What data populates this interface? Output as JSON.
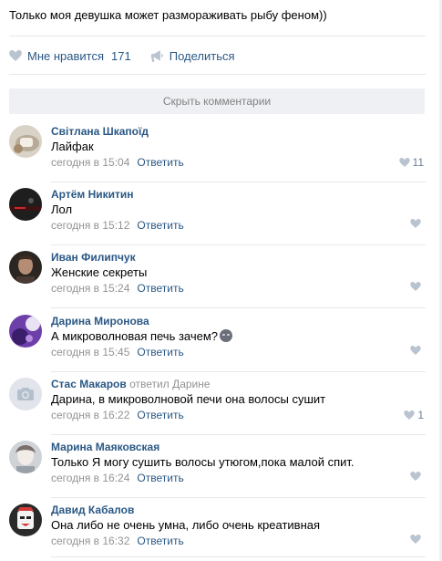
{
  "post": {
    "text": "Только моя девушка может размораживать рыбу феном))",
    "like_label": "Мне нравится",
    "like_count": "171",
    "share_label": "Поделиться"
  },
  "hide_comments_label": "Скрыть комментарии",
  "reply_label": "Ответить",
  "comments": [
    {
      "author": "Світлана Шкапоїд",
      "text": "Лайфак",
      "time": "сегодня в 15:04",
      "likes": "11"
    },
    {
      "author": "Артём Никитин",
      "text": "Лол",
      "time": "сегодня в 15:12",
      "likes": ""
    },
    {
      "author": "Иван Филипчук",
      "text": "Женские секреты",
      "time": "сегодня в 15:24",
      "likes": ""
    },
    {
      "author": "Дарина Миронова",
      "text": "А микроволновая печь зачем?",
      "time": "сегодня в 15:45",
      "likes": ""
    },
    {
      "author": "Стас Макаров",
      "replied": "ответил",
      "target": "Дарине",
      "text": "Дарина, в микроволновой печи она волосы сушит",
      "time": "сегодня в 16:22",
      "likes": "1"
    },
    {
      "author": "Марина Маяковская",
      "text": "Только Я могу сушить волосы утюгом,пока малой спит.",
      "time": "сегодня в 16:24",
      "likes": ""
    },
    {
      "author": "Давид Кабалов",
      "text": "Она либо не очень умна, либо очень креативная",
      "time": "сегодня в 16:32",
      "likes": ""
    }
  ],
  "colors": {
    "link": "#2a5885",
    "muted": "#939393",
    "like_icon": "#b9c4d0"
  },
  "icons": {
    "like": "heart-icon",
    "share": "megaphone-icon",
    "camera": "camera-placeholder-icon"
  }
}
